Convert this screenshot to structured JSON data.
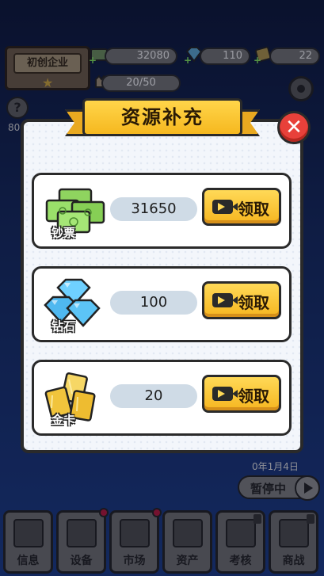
{
  "hud": {
    "company_label": "初创企业",
    "cash": "32080",
    "diamonds": "110",
    "gold": "22",
    "stamina": "20/50",
    "side_number": "80"
  },
  "status": {
    "date": "0年1月4日",
    "pause_label": "暂停中"
  },
  "tabs": [
    {
      "label": "信息",
      "icon": "monitor-icon",
      "badge": false,
      "locked": false
    },
    {
      "label": "设备",
      "icon": "printer-icon",
      "badge": true,
      "locked": false
    },
    {
      "label": "市场",
      "icon": "building-icon",
      "badge": true,
      "locked": false
    },
    {
      "label": "资产",
      "icon": "chart-icon",
      "badge": false,
      "locked": false
    },
    {
      "label": "考核",
      "icon": "documents-icon",
      "badge": false,
      "locked": true
    },
    {
      "label": "商战",
      "icon": "chess-icon",
      "badge": false,
      "locked": true
    }
  ],
  "modal": {
    "title": "资源补充",
    "close_icon": "close-icon",
    "items": [
      {
        "name": "钞票",
        "amount": "31650",
        "button": "领取",
        "icon": "cash-stack-icon",
        "color": "#7ecb4f"
      },
      {
        "name": "钻石",
        "amount": "100",
        "button": "领取",
        "icon": "diamond-icon",
        "color": "#4fb8f0"
      },
      {
        "name": "金卡",
        "amount": "20",
        "button": "领取",
        "icon": "gold-card-icon",
        "color": "#f1c43c"
      }
    ]
  }
}
